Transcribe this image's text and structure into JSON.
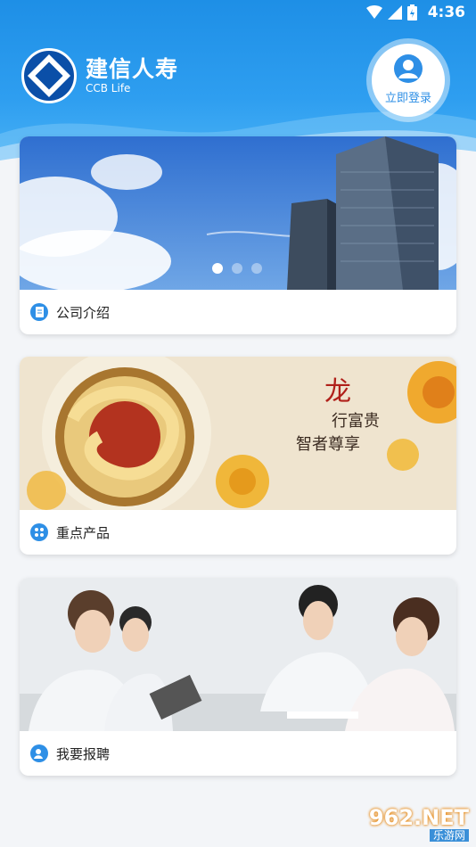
{
  "status": {
    "time": "4:36"
  },
  "header": {
    "brand_cn": "建信人寿",
    "brand_en": "CCB Life",
    "login_label": "立即登录"
  },
  "cards": [
    {
      "label": "公司介绍",
      "icon": "document-icon",
      "page_indicator": {
        "count": 3,
        "active": 1
      }
    },
    {
      "label": "重点产品",
      "icon": "grid-icon"
    },
    {
      "label": "我要报聘",
      "icon": "user-edit-icon"
    }
  ],
  "banner2": {
    "calligraphy": [
      "龙",
      "行富贵",
      "智者尊享"
    ]
  },
  "watermark": {
    "main": "962.NET",
    "sub": "乐游网"
  },
  "colors": {
    "primary": "#2e8fe6",
    "logo_blue": "#0b4fa8"
  }
}
